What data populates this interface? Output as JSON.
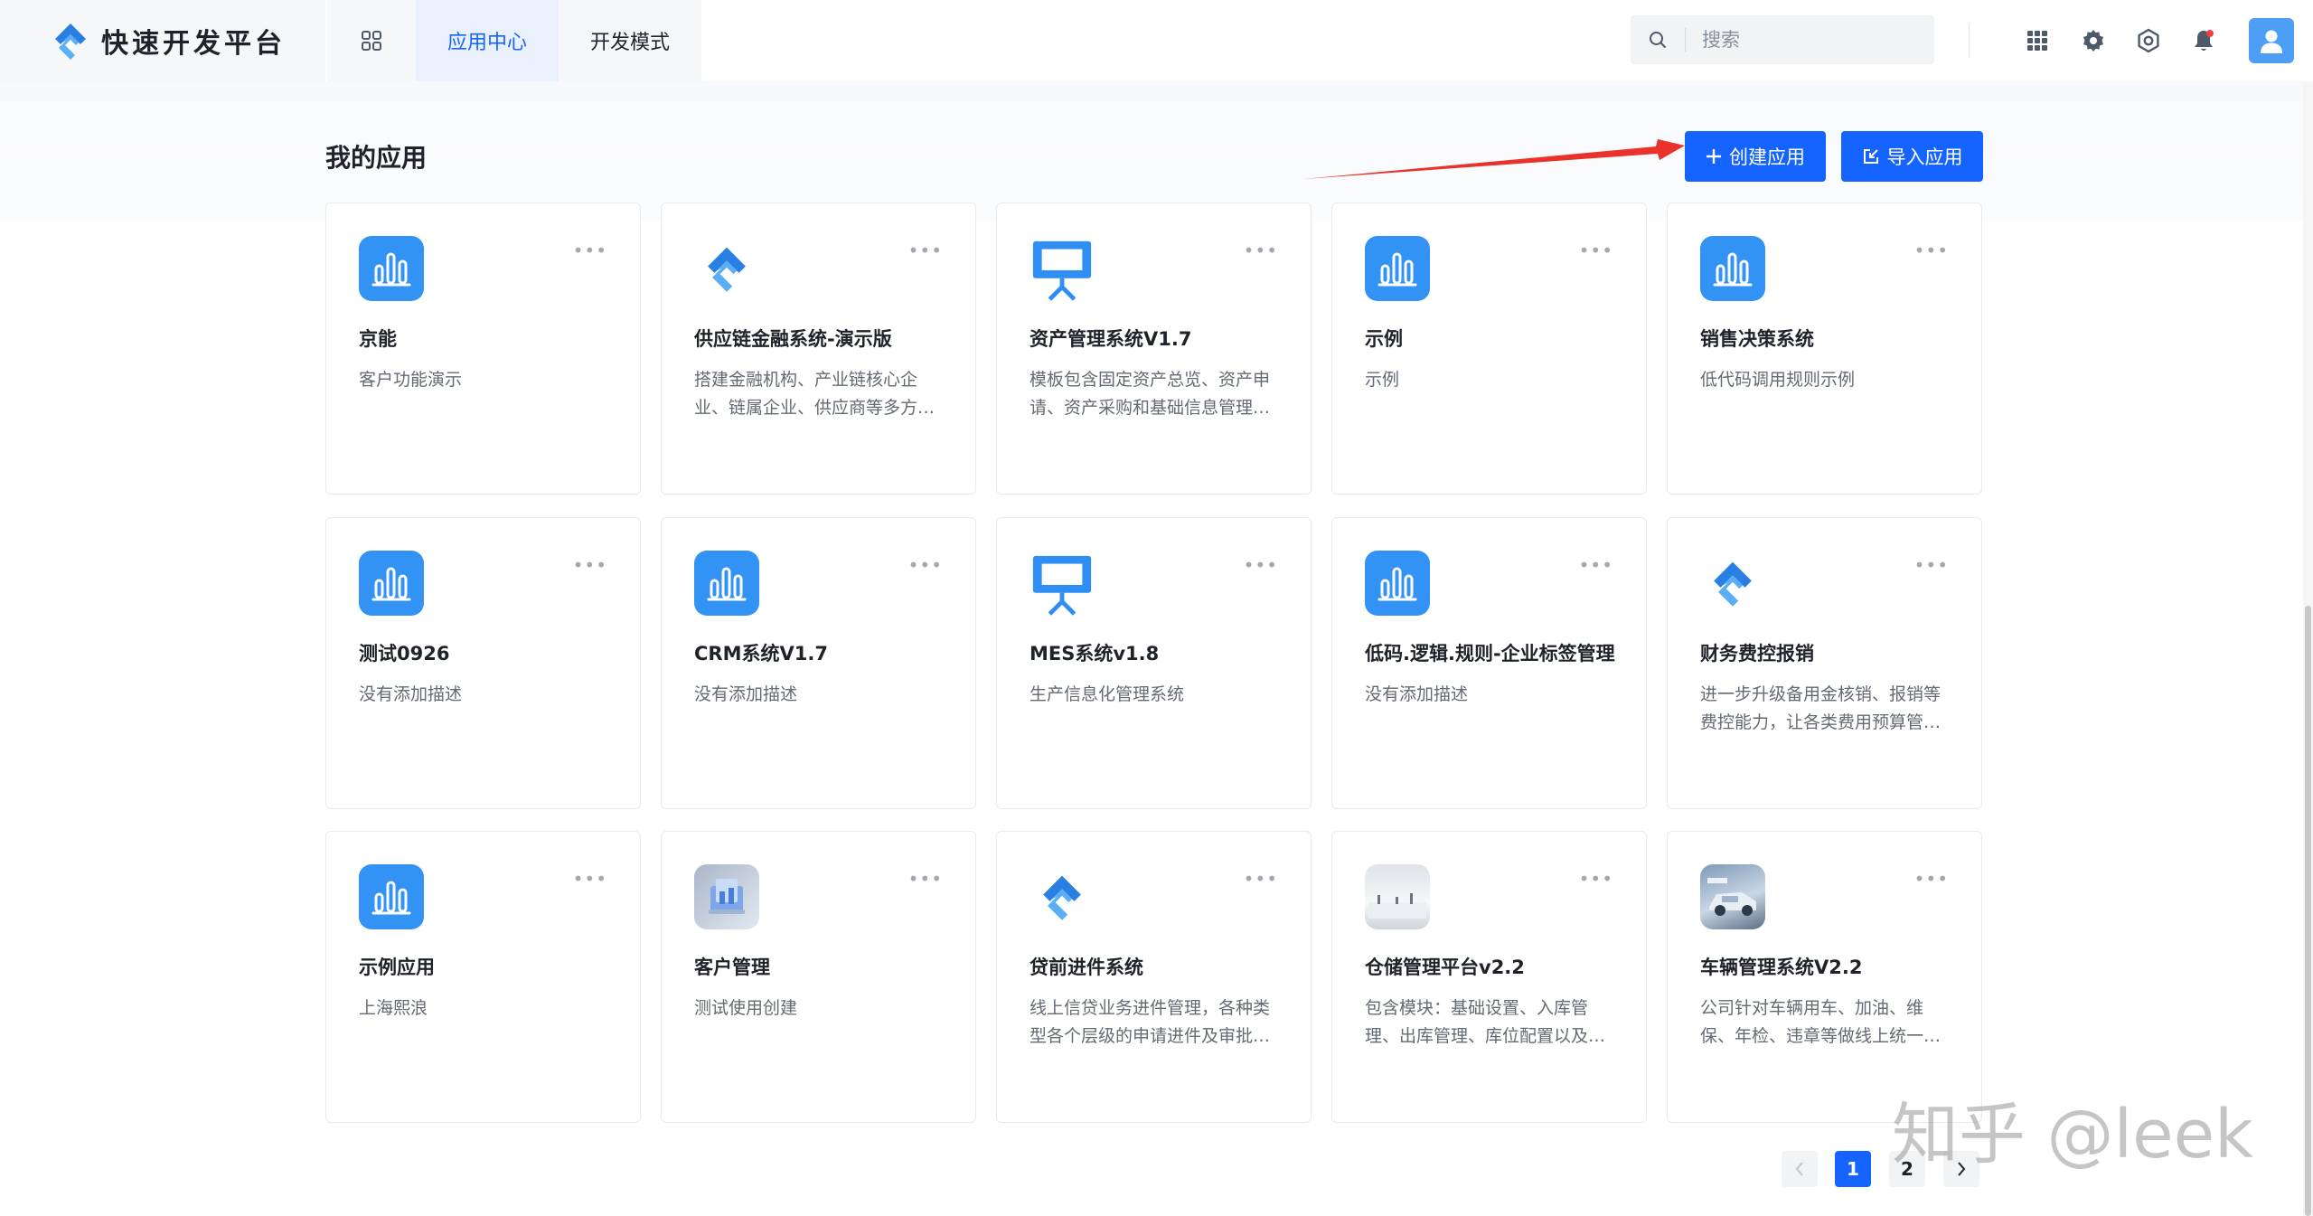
{
  "header": {
    "app_title": "快速开发平台",
    "tabs": [
      {
        "label": "应用中心",
        "active": true
      },
      {
        "label": "开发模式",
        "active": false
      }
    ],
    "search_placeholder": "搜索"
  },
  "page": {
    "title": "我的应用",
    "create_button": "创建应用",
    "import_button": "导入应用"
  },
  "apps": [
    {
      "title": "京能",
      "desc": "客户功能演示",
      "icon": "bar-chart-icon"
    },
    {
      "title": "供应链金融系统-演示版",
      "desc": "搭建金融机构、产业链核心企业、链属企业、供应商等多方参与的供应链金融平台",
      "icon": "platform-logo-icon"
    },
    {
      "title": "资产管理系统V1.7",
      "desc": "模板包含固定资产总览、资产申请、资产采购和基础信息管理等功能",
      "icon": "presentation-icon"
    },
    {
      "title": "示例",
      "desc": "示例",
      "icon": "bar-chart-icon"
    },
    {
      "title": "销售决策系统",
      "desc": "低代码调用规则示例",
      "icon": "bar-chart-icon"
    },
    {
      "title": "测试0926",
      "desc": "没有添加描述",
      "icon": "bar-chart-icon"
    },
    {
      "title": "CRM系统V1.7",
      "desc": "没有添加描述",
      "icon": "bar-chart-icon"
    },
    {
      "title": "MES系统v1.8",
      "desc": "生产信息化管理系统",
      "icon": "presentation-icon"
    },
    {
      "title": "低码.逻辑.规则-企业标签管理",
      "desc": "没有添加描述",
      "icon": "bar-chart-icon"
    },
    {
      "title": "财务费控报销",
      "desc": "进一步升级备用金核销、报销等费控能力，让各类费用预算管控更加灵活",
      "icon": "platform-logo-icon"
    },
    {
      "title": "示例应用",
      "desc": "上海熙浪",
      "icon": "bar-chart-icon"
    },
    {
      "title": "客户管理",
      "desc": "测试使用创建",
      "icon": "customer-image-icon"
    },
    {
      "title": "贷前进件系统",
      "desc": "线上信贷业务进件管理，各种类型各个层级的申请进件及审批流程",
      "icon": "platform-logo-icon"
    },
    {
      "title": "仓储管理平台v2.2",
      "desc": "包含模块：基础设置、入库管理、出库管理、库位配置以及库存盘点等",
      "icon": "warehouse-image-icon"
    },
    {
      "title": "车辆管理系统V2.2",
      "desc": "公司针对车辆用车、加油、维保、年检、违章等做线上统一管理",
      "icon": "car-image-icon"
    }
  ],
  "pagination": {
    "pages": [
      "1",
      "2"
    ],
    "current": "1"
  },
  "watermark": "知乎 @leek",
  "colors": {
    "primary": "#1664ff",
    "app_icon_blue": "#3293f5",
    "annotation_arrow": "#e8322b"
  }
}
